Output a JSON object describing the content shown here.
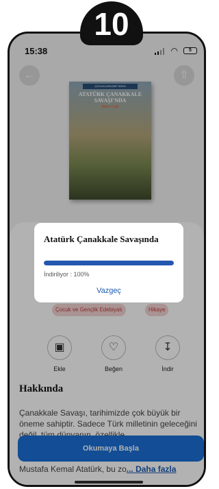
{
  "step_badge": "10",
  "status_bar": {
    "time": "15:38",
    "battery": "5"
  },
  "header": {
    "back_icon": "arrow-left-icon",
    "share_icon": "share-icon"
  },
  "book": {
    "cover_series": "ÇOCUKLARA BİR TARİH",
    "cover_title": "ATATÜRK ÇANAKKALE SAVAŞI'NDA",
    "cover_author": "Metin Celâl"
  },
  "tags": [
    "Çocuk ve Gençlik Edebiyatı",
    "Hikaye"
  ],
  "actions": [
    {
      "label": "Ekle",
      "icon": "bookmark-add-icon"
    },
    {
      "label": "Beğen",
      "icon": "heart-icon"
    },
    {
      "label": "İndir",
      "icon": "download-icon"
    }
  ],
  "about": {
    "title": "Hakkında",
    "text": "Çanakkale Savaşı, tarihimizde çok büyük bir öneme sahiptir. Sadece Türk milletinin geleceğini değil, tüm dünyanın, özellikle"
  },
  "read_button": "Okumaya Başla",
  "more_text": "Mustafa Kemal Atatürk, bu zo",
  "more_link": "... Daha fazla",
  "dialog": {
    "title": "Atatürk Çanakkale Savaşında",
    "status_text": "İndiriliyor : 100%",
    "progress": 1.0,
    "cancel_label": "Vazgeç"
  },
  "colors": {
    "accent": "#2357b0",
    "primary_button": "#1a6fd6",
    "tag_text": "#c23b3b"
  }
}
